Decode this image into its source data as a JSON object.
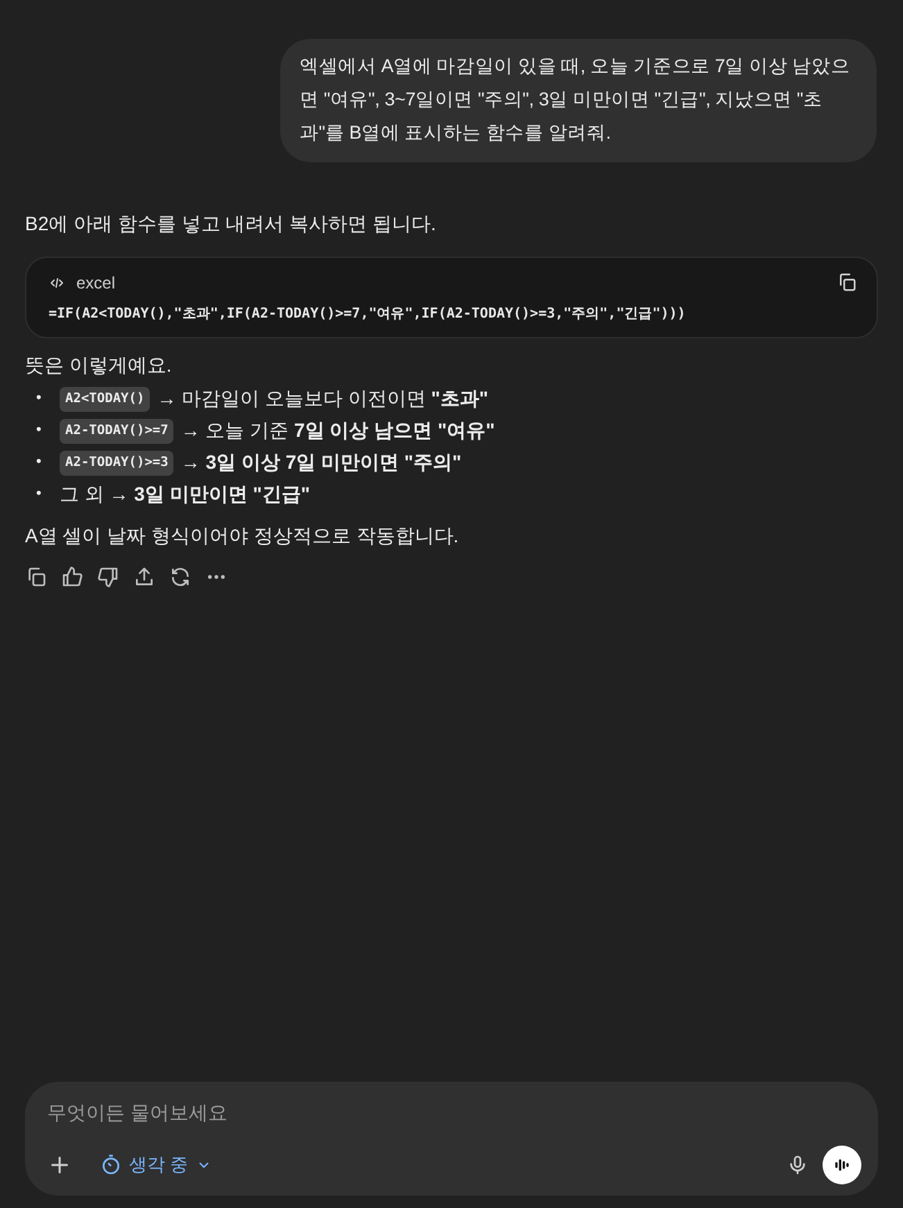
{
  "user_message": {
    "text": "엑셀에서 A열에 마감일이 있을 때, 오늘 기준으로 7일 이상 남았으면 \"여유\", 3~7일이면 \"주의\", 3일 미만이면 \"긴급\", 지났으면 \"초과\"를 B열에 표시하는 함수를 알려줘."
  },
  "assistant_message": {
    "intro": "B2에 아래 함수를 넣고 내려서 복사하면 됩니다.",
    "code_block": {
      "language": "excel",
      "code": "=IF(A2<TODAY(),\"초과\",IF(A2-TODAY()>=7,\"여유\",IF(A2-TODAY()>=3,\"주의\",\"긴급\")))"
    },
    "explanation_title": "뜻은 이렇게예요.",
    "bullets": [
      {
        "marker": "•",
        "code": "A2<TODAY()",
        "text": "→ 마감일이 오늘보다 이전이면 **\"초과\"**"
      },
      {
        "marker": "•",
        "code": "A2-TODAY()>=7",
        "text": "→ 오늘 기준 **7일 이상 남으면 \"여유\"**"
      },
      {
        "marker": "•",
        "code": "A2-TODAY()>=3",
        "text": "→ **3일 이상 7일 미만이면 \"주의\"**"
      },
      {
        "marker": "•",
        "text": "그 외 → **3일 미만이면 \"긴급\"**"
      }
    ],
    "note": "A열 셀이 날짜 형식이어야 정상적으로 작동합니다."
  },
  "composer": {
    "placeholder": "무엇이든 물어보세요",
    "mode_label": "생각 중"
  }
}
